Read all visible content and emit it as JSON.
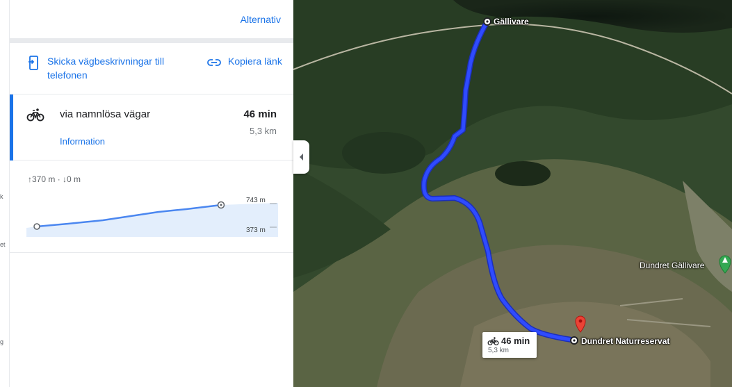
{
  "panel": {
    "alternatives_label": "Alternativ",
    "send_label": "Skicka vägbeskrivningar till telefonen",
    "copy_label": "Kopiera länk"
  },
  "route": {
    "mode_icon": "bicycle-icon",
    "via": "via namnlösa vägar",
    "duration": "46 min",
    "distance": "5,3 km",
    "details_link": "Information",
    "accent_color": "#1a73e8"
  },
  "elevation": {
    "ascent": "↑370 m",
    "descent": "↓0 m",
    "separator": "·",
    "max_label": "743 m",
    "min_label": "373 m"
  },
  "map": {
    "origin_label": "Gällivare",
    "destination_label": "Dundret Naturreservat",
    "poi_label": "Dundret Gällivare",
    "route_color": "#2f4bff",
    "callout": {
      "duration": "46 min",
      "distance": "5,3 km"
    }
  },
  "edge_letters": [
    "k",
    "et",
    "g"
  ]
}
